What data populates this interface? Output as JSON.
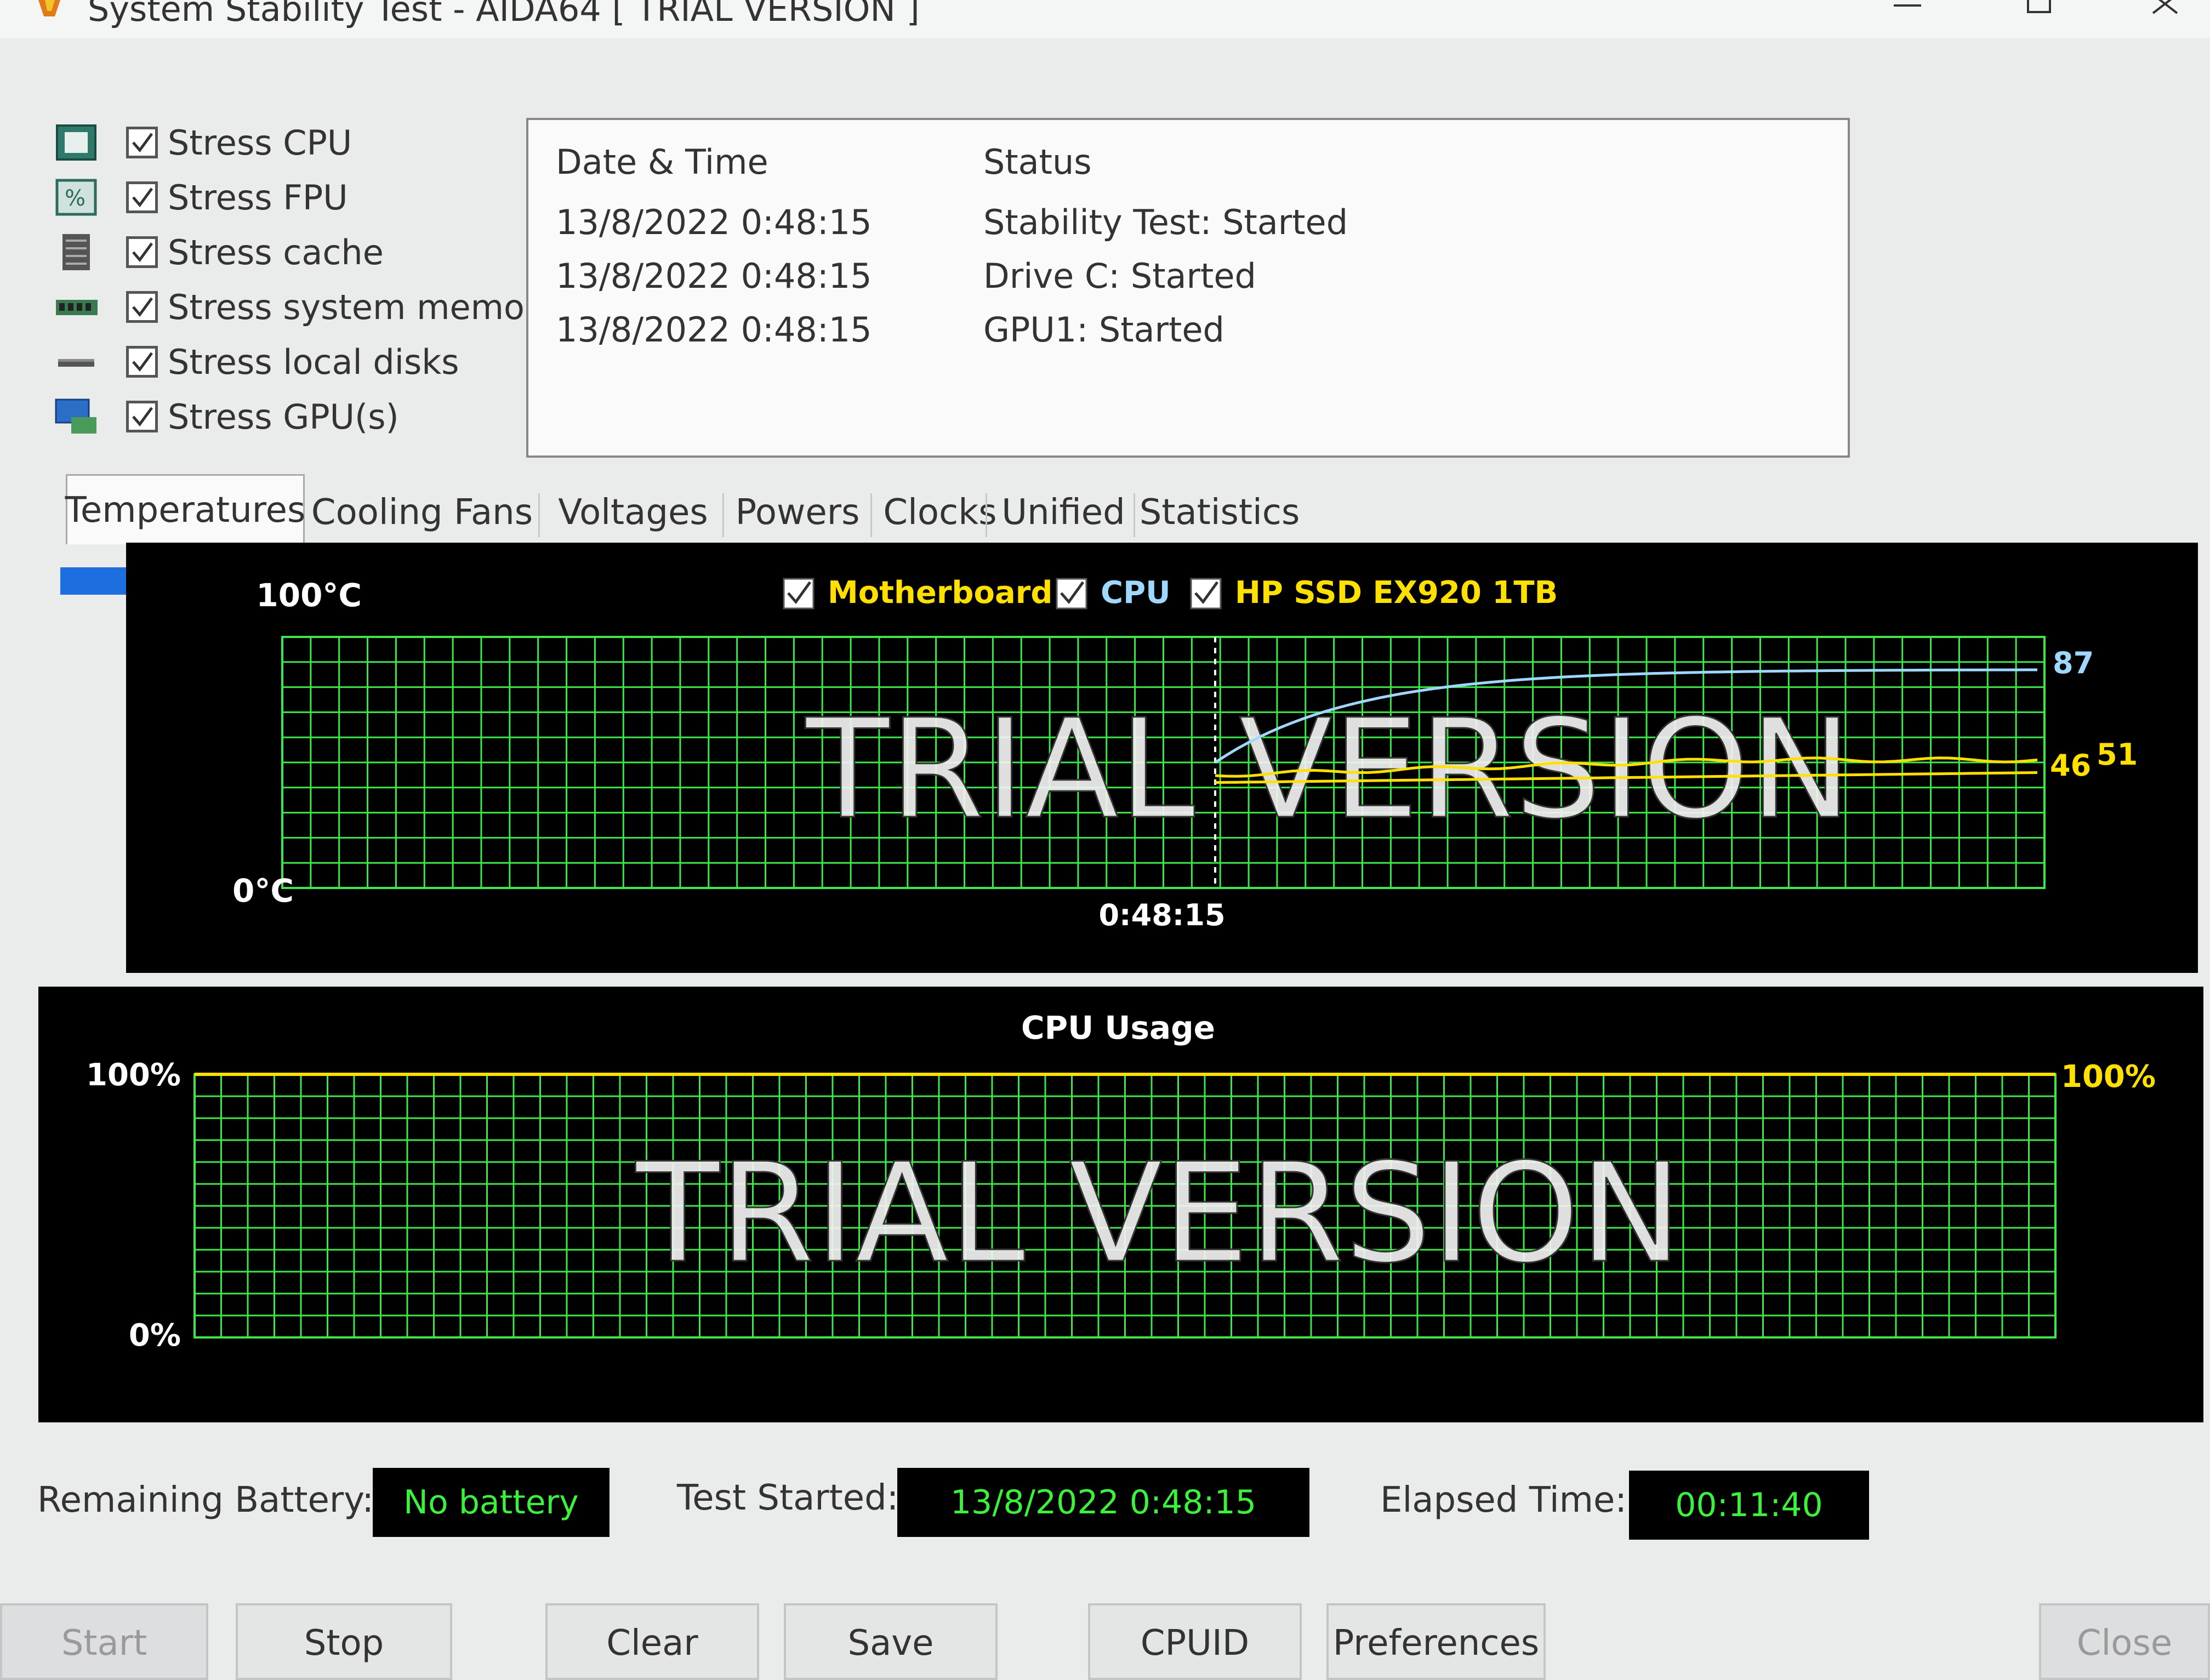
{
  "window": {
    "title": "System Stability Test - AIDA64  [ TRIAL VERSION ]"
  },
  "stress_options": [
    {
      "label": "Stress CPU",
      "checked": true,
      "icon": "cpu-chip-icon"
    },
    {
      "label": "Stress FPU",
      "checked": true,
      "icon": "fpu-percent-icon"
    },
    {
      "label": "Stress cache",
      "checked": true,
      "icon": "cache-icon"
    },
    {
      "label": "Stress system memory",
      "checked": true,
      "icon": "memory-module-icon"
    },
    {
      "label": "Stress local disks",
      "checked": true,
      "icon": "disk-icon"
    },
    {
      "label": "Stress GPU(s)",
      "checked": true,
      "icon": "gpu-monitor-icon"
    }
  ],
  "log": {
    "headers": [
      "Date & Time",
      "Status"
    ],
    "rows": [
      [
        "13/8/2022 0:48:15",
        "Stability Test: Started"
      ],
      [
        "13/8/2022 0:48:15",
        "Drive C: Started"
      ],
      [
        "13/8/2022 0:48:15",
        "GPU1: Started"
      ]
    ]
  },
  "tabs": [
    "Temperatures",
    "Cooling Fans",
    "Voltages",
    "Powers",
    "Clocks",
    "Unified",
    "Statistics"
  ],
  "active_tab": "Temperatures",
  "temperature_chart": {
    "legend": [
      {
        "label": "Motherboard",
        "checked": true,
        "color": "#ffe000"
      },
      {
        "label": "CPU",
        "checked": true,
        "color": "#9fd8ff"
      },
      {
        "label": "HP SSD EX920 1TB",
        "checked": true,
        "color": "#ffe000"
      }
    ],
    "y_max_label": "100°C",
    "y_min_label": "0°C",
    "x_marker_label": "0:48:15",
    "end_labels": {
      "cpu": "87",
      "a": "46",
      "b": "51"
    },
    "watermark": "TRIAL VERSION"
  },
  "cpu_chart": {
    "title": "CPU Usage",
    "y_max_label": "100%",
    "y_min_label": "0%",
    "end_label": "100%",
    "watermark": "TRIAL VERSION"
  },
  "chart_data": [
    {
      "type": "line",
      "title": "",
      "ylim": [
        0,
        100
      ],
      "ylabel": "°C",
      "series": [
        {
          "name": "CPU",
          "color": "#9fd8ff",
          "start_value": 50,
          "end_value": 87
        },
        {
          "name": "Motherboard",
          "color": "#ffe000",
          "end_value": 46
        },
        {
          "name": "HP SSD EX920 1TB",
          "color": "#ffe000",
          "end_value": 51
        }
      ],
      "marker_time": "0:48:15",
      "grid": true
    },
    {
      "type": "line",
      "title": "CPU Usage",
      "ylim": [
        0,
        100
      ],
      "series": [
        {
          "name": "CPU",
          "color": "#ffe000",
          "value": 100
        }
      ],
      "grid": true
    }
  ],
  "footer": {
    "battery_label": "Remaining Battery:",
    "battery_value": "No battery",
    "started_label": "Test Started:",
    "started_value": "13/8/2022 0:48:15",
    "elapsed_label": "Elapsed Time:",
    "elapsed_value": "00:11:40"
  },
  "buttons": {
    "start": "Start",
    "stop": "Stop",
    "clear": "Clear",
    "save": "Save",
    "cpuid": "CPUID",
    "preferences": "Preferences",
    "close": "Close"
  }
}
